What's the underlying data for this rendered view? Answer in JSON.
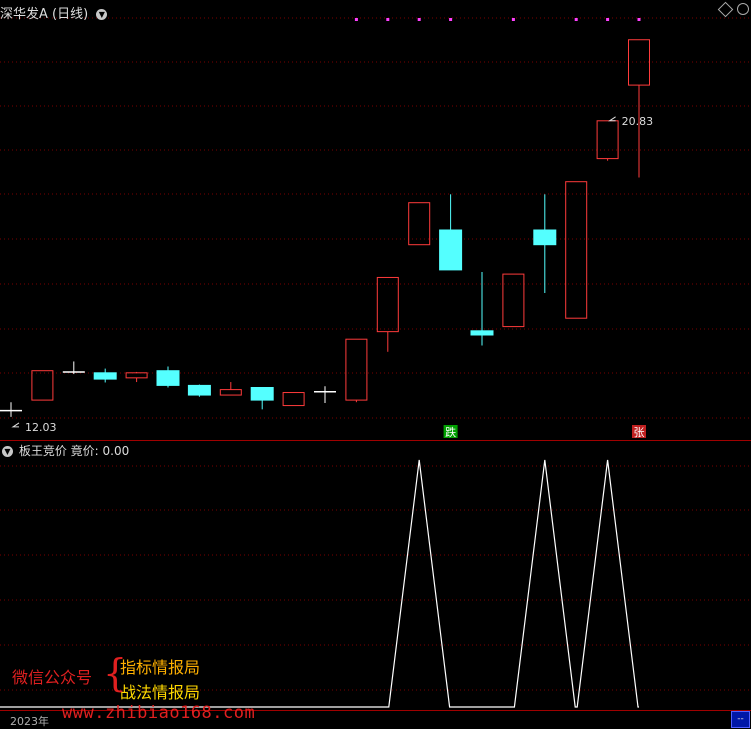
{
  "header": {
    "title": "深华发A (日线)",
    "indicator_name": "板王竞价",
    "indicator_value": "竟价: 0.00"
  },
  "watermark": {
    "left": "微信公众号",
    "brace": "{",
    "right_1": "指标情报局",
    "right_2": "战法情报局",
    "url": "www.zhibiao168.com"
  },
  "footer": {
    "year": "2023年",
    "scroll": "--"
  },
  "colors": {
    "up": "#ff3b3b",
    "down": "#54ffff",
    "doji": "#ffffff",
    "grid": "#7a0000",
    "divider": "#a00000",
    "signal_dot": "#ff40ff",
    "indicator_line": "#ffffff"
  },
  "chart_data": [
    {
      "type": "candlestick",
      "title": "深华发A (日线)",
      "price_range": [
        11.3,
        21.3
      ],
      "grid": true,
      "annotations": [
        {
          "index": 0,
          "label": "12.03",
          "text": "12.03"
        },
        {
          "index": 19,
          "label": "20.83",
          "text": "20.83"
        }
      ],
      "markers": [
        {
          "index": 14,
          "text": "跌",
          "color": "#00c000"
        },
        {
          "index": 20,
          "text": "张",
          "color": "#ff3030"
        }
      ],
      "signal_dots": [
        11,
        12,
        13,
        14,
        16,
        18,
        19,
        20
      ],
      "candles": [
        {
          "open": 12.0,
          "close": 12.0,
          "high": 12.2,
          "low": 11.85
        },
        {
          "open": 12.25,
          "close": 12.95,
          "high": 12.95,
          "low": 12.25
        },
        {
          "open": 12.92,
          "close": 12.92,
          "high": 13.17,
          "low": 12.87
        },
        {
          "open": 12.9,
          "close": 12.75,
          "high": 13.0,
          "low": 12.67
        },
        {
          "open": 12.78,
          "close": 12.9,
          "high": 12.92,
          "low": 12.68
        },
        {
          "open": 12.95,
          "close": 12.6,
          "high": 13.05,
          "low": 12.55
        },
        {
          "open": 12.6,
          "close": 12.37,
          "high": 12.62,
          "low": 12.33
        },
        {
          "open": 12.37,
          "close": 12.5,
          "high": 12.68,
          "low": 12.37
        },
        {
          "open": 12.55,
          "close": 12.25,
          "high": 12.55,
          "low": 12.03
        },
        {
          "open": 12.12,
          "close": 12.43,
          "high": 12.43,
          "low": 12.12
        },
        {
          "open": 12.45,
          "close": 12.45,
          "high": 12.58,
          "low": 12.18
        },
        {
          "open": 12.25,
          "close": 13.7,
          "high": 13.7,
          "low": 12.2
        },
        {
          "open": 13.88,
          "close": 15.17,
          "high": 15.17,
          "low": 13.4
        },
        {
          "open": 15.95,
          "close": 16.95,
          "high": 16.95,
          "low": 15.95
        },
        {
          "open": 16.3,
          "close": 15.35,
          "high": 17.15,
          "low": 15.35
        },
        {
          "open": 13.9,
          "close": 13.8,
          "high": 15.3,
          "low": 13.55
        },
        {
          "open": 14.0,
          "close": 15.25,
          "high": 15.25,
          "low": 14.0
        },
        {
          "open": 16.3,
          "close": 15.95,
          "high": 17.15,
          "low": 14.8
        },
        {
          "open": 14.2,
          "close": 17.45,
          "high": 17.45,
          "low": 14.2
        },
        {
          "open": 18.0,
          "close": 18.9,
          "high": 18.9,
          "low": 17.95
        },
        {
          "open": 19.75,
          "close": 20.83,
          "high": 20.83,
          "low": 17.55
        }
      ]
    },
    {
      "type": "line",
      "title": "板王竞价",
      "series": [
        {
          "name": "竟价",
          "values": [
            0,
            0,
            0,
            0,
            0,
            0,
            0,
            0,
            0,
            0,
            0,
            0,
            0,
            1,
            0,
            0,
            0,
            1,
            0,
            1,
            0
          ]
        }
      ],
      "ylim": [
        0,
        1
      ],
      "grid": true
    }
  ]
}
